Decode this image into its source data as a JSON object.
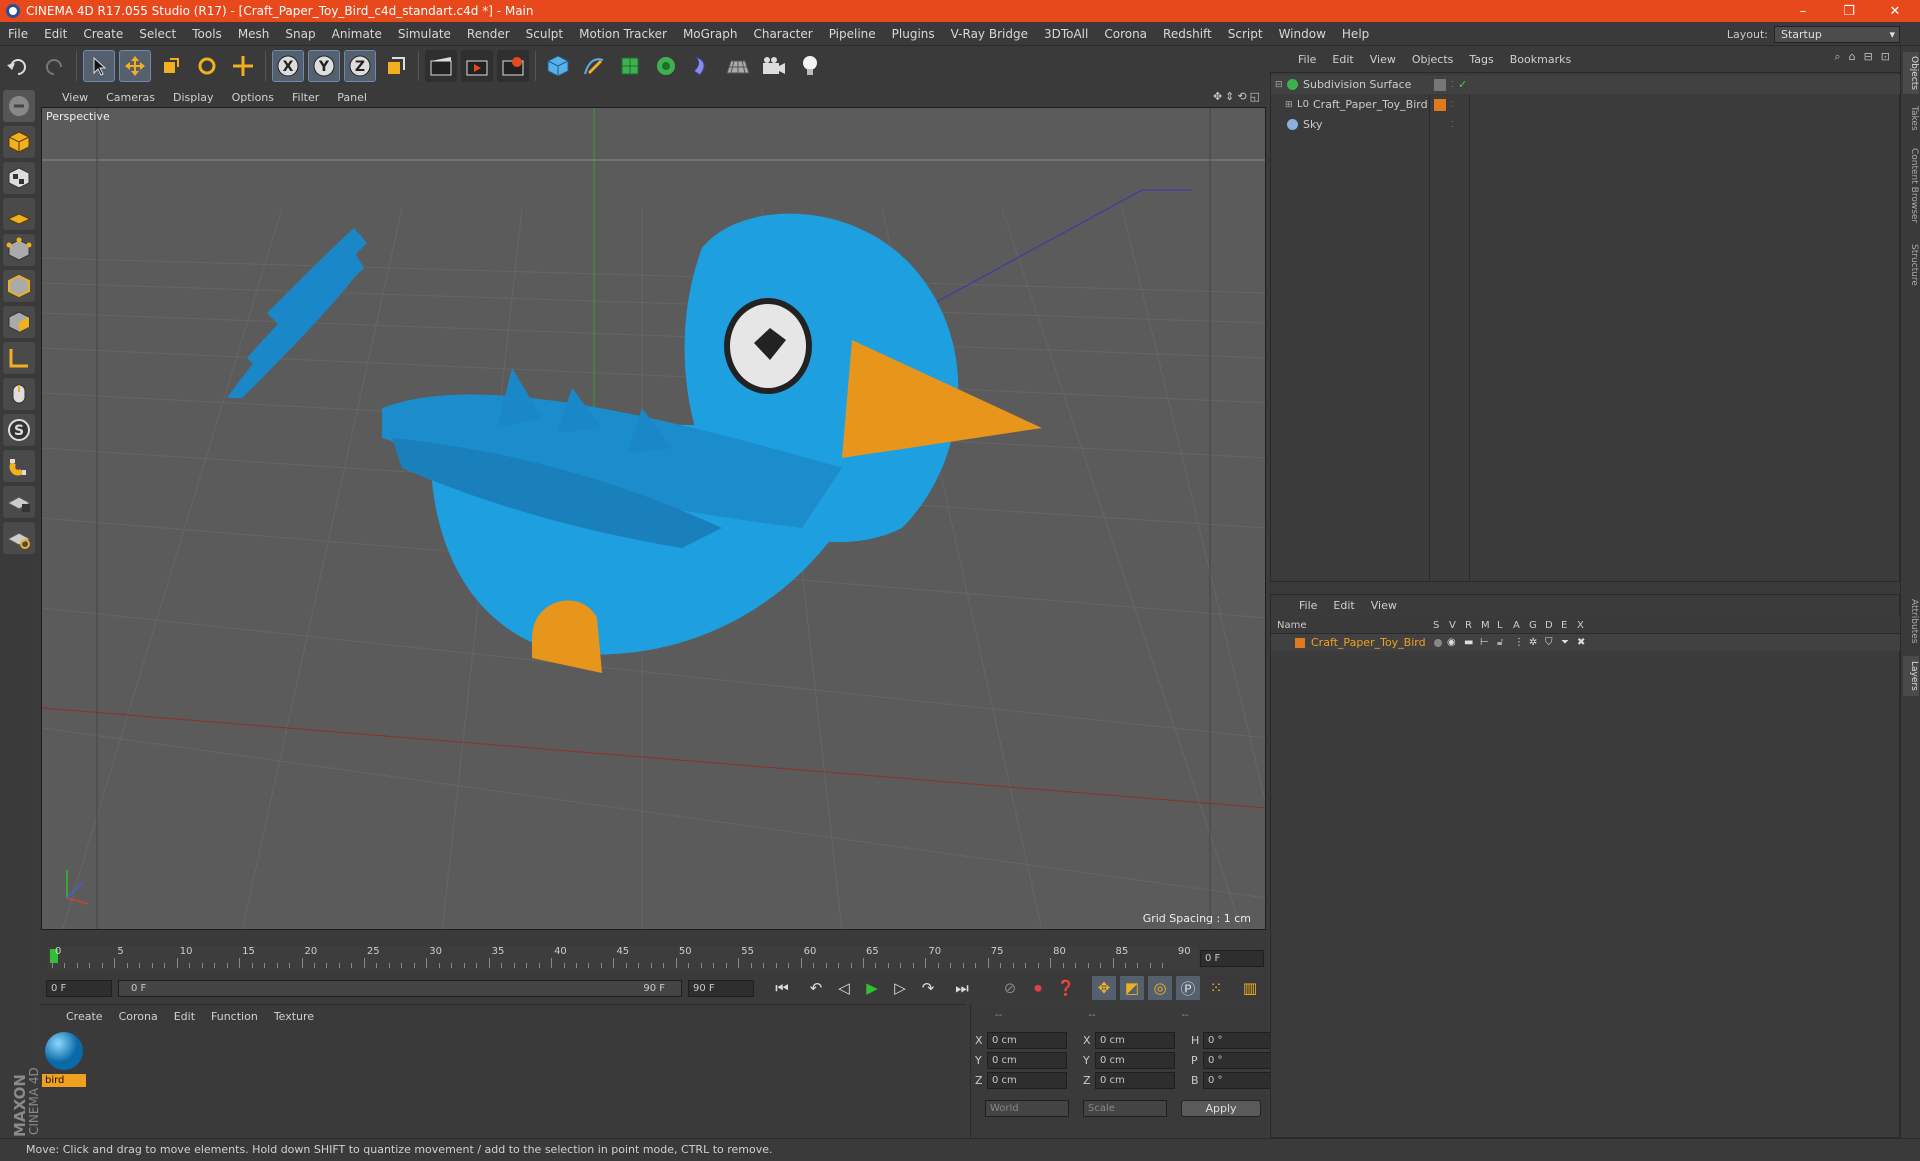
{
  "window": {
    "title": "CINEMA 4D R17.055 Studio (R17) - [Craft_Paper_Toy_Bird_c4d_standart.c4d *] - Main",
    "controls": [
      "–",
      "❐",
      "✕"
    ]
  },
  "menu": [
    "File",
    "Edit",
    "Create",
    "Select",
    "Tools",
    "Mesh",
    "Snap",
    "Animate",
    "Simulate",
    "Render",
    "Sculpt",
    "Motion Tracker",
    "MoGraph",
    "Character",
    "Pipeline",
    "Plugins",
    "V-Ray Bridge",
    "3DToAll",
    "Corona",
    "Redshift",
    "Script",
    "Window",
    "Help"
  ],
  "layout": {
    "label": "Layout:",
    "value": "Startup"
  },
  "viewport": {
    "menu": [
      "View",
      "Cameras",
      "Display",
      "Options",
      "Filter",
      "Panel"
    ],
    "camera_label": "Perspective",
    "grid_spacing": "Grid Spacing : 1 cm"
  },
  "timeline": {
    "ticks": [
      "0",
      "5",
      "10",
      "15",
      "20",
      "25",
      "30",
      "35",
      "40",
      "45",
      "50",
      "55",
      "60",
      "65",
      "70",
      "75",
      "80",
      "85",
      "90"
    ],
    "current_frame": "0 F"
  },
  "transport": {
    "start": "0 F",
    "range_start": "0 F",
    "range_end": "90 F",
    "end": "90 F"
  },
  "material_manager": {
    "menu": [
      "Create",
      "Corona",
      "Edit",
      "Function",
      "Texture"
    ],
    "materials": [
      {
        "name": "bird"
      }
    ]
  },
  "coordinates": {
    "header": [
      "--",
      "--",
      "--"
    ],
    "rows": [
      {
        "a": "X",
        "av": "0 cm",
        "b": "X",
        "bv": "0 cm",
        "c": "H",
        "cv": "0 °"
      },
      {
        "a": "Y",
        "av": "0 cm",
        "b": "Y",
        "bv": "0 cm",
        "c": "P",
        "cv": "0 °"
      },
      {
        "a": "Z",
        "av": "0 cm",
        "b": "Z",
        "bv": "0 cm",
        "c": "B",
        "cv": "0 °"
      }
    ],
    "mode": "World",
    "size_mode": "Scale",
    "apply": "Apply"
  },
  "object_manager": {
    "menu": [
      "File",
      "Edit",
      "View",
      "Objects",
      "Tags",
      "Bookmarks"
    ],
    "objects": [
      {
        "name": "Subdivision Surface",
        "indent": 0
      },
      {
        "name": "Craft_Paper_Toy_Bird",
        "indent": 1
      },
      {
        "name": "Sky",
        "indent": 0
      }
    ]
  },
  "layer_manager": {
    "menu": [
      "File",
      "Edit",
      "View"
    ],
    "columns": [
      "Name",
      "S",
      "V",
      "R",
      "M",
      "L",
      "A",
      "G",
      "D",
      "E",
      "X"
    ],
    "layers": [
      {
        "name": "Craft_Paper_Toy_Bird"
      }
    ]
  },
  "side_tabs": [
    "Objects",
    "Takes",
    "Content Browser",
    "Structure",
    "Attributes",
    "Layers"
  ],
  "brand": {
    "line1": "MAXON",
    "line2": "CINEMA 4D"
  },
  "status": "Move: Click and drag to move elements. Hold down SHIFT to quantize movement / add to the selection in point mode, CTRL to remove.",
  "colors": {
    "accent": "#e8491c",
    "bird_blue": "#1e9fe0",
    "beak_orange": "#e8951c",
    "layer_orange": "#e07a20"
  }
}
